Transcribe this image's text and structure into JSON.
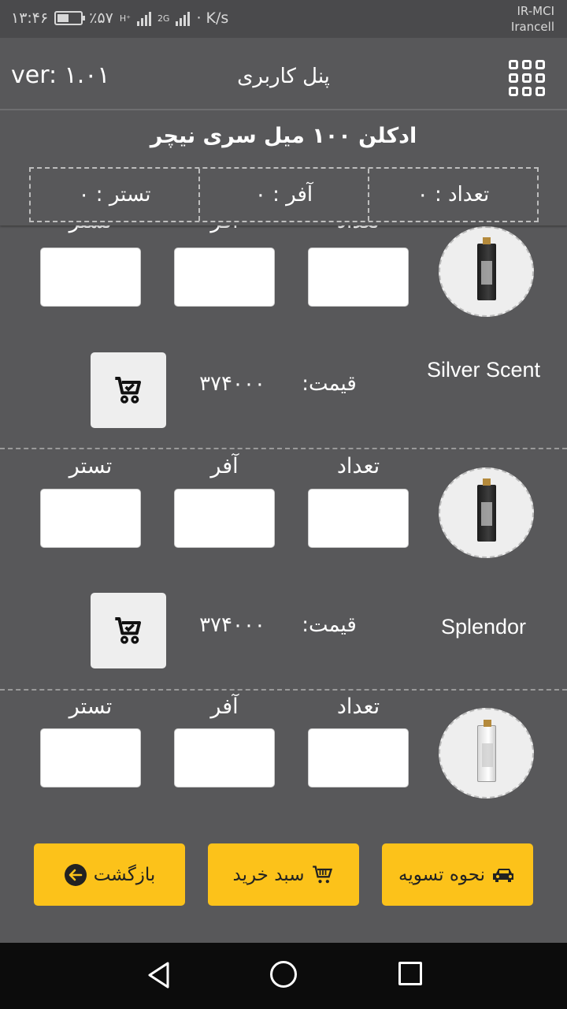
{
  "status_bar": {
    "time": "۱۳:۴۶",
    "battery": "٪۵۷",
    "network1": "H⁺",
    "network2": "2G",
    "speed": "· K/s",
    "carrier1": "IR-MCI",
    "carrier2": "Irancell"
  },
  "app_bar": {
    "version": "ver: ۱.۰۱",
    "title": "پنل کاربری",
    "menu_icon": "grid-icon"
  },
  "summary": {
    "product_title": "ادکلن ۱۰۰ میل سری نیچر",
    "count_label": "تعداد : ۰",
    "offer_label": "آفر : ۰",
    "tester_label": "تستر : ۰"
  },
  "products": [
    {
      "name": "Silver Scent",
      "qty_label": "تعداد",
      "offer_label": "آفر",
      "tester_label": "تستر",
      "price_label": "قیمت:",
      "price": "۳۷۴۰۰۰",
      "qty_value": "",
      "offer_value": "",
      "tester_value": ""
    },
    {
      "name": "Splendor",
      "qty_label": "تعداد",
      "offer_label": "آفر",
      "tester_label": "تستر",
      "price_label": "قیمت:",
      "price": "۳۷۴۰۰۰",
      "qty_value": "",
      "offer_value": "",
      "tester_value": ""
    },
    {
      "name": "",
      "qty_label": "تعداد",
      "offer_label": "آفر",
      "tester_label": "تستر",
      "price_label": "",
      "price": "",
      "qty_value": "",
      "offer_value": "",
      "tester_value": ""
    }
  ],
  "buttons": {
    "settlement": "نحوه تسویه",
    "cart": "سبد خرید",
    "back": "بازگشت"
  },
  "colors": {
    "background": "#58585a",
    "accent": "#fcc21a",
    "nav": "#0c0c0c"
  }
}
